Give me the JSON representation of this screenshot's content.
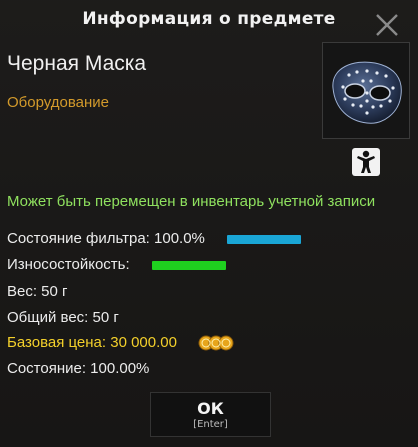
{
  "dialog": {
    "title": "Информация о предмете",
    "close_icon": "close-icon"
  },
  "item": {
    "name": "Черная Маска",
    "category": "Оборудование",
    "image_icon": "hockey-mask-icon",
    "badge_icon": "character-figure-icon",
    "account_note": "Может быть перемещен в инвентарь учетной записи"
  },
  "stats": {
    "filter_label": "Состояние фильтра: 100.0%",
    "filter_level": 1.0,
    "filter_color": "#1aa6d6",
    "durability_label": "Износостойкость:",
    "durability_level": 1.0,
    "durability_color": "#1fd01f",
    "weight": "Вес: 50 г",
    "total_weight": "Общий вес: 50 г",
    "base_price": "Базовая цена: 30 000.00",
    "coins_icon": "coins-icon",
    "condition": "Состояние: 100.00%"
  },
  "buttons": {
    "ok_label": "ОК",
    "ok_hotkey": "[Enter]"
  },
  "colors": {
    "category": "#d39a2b",
    "account_note": "#8fe15f",
    "price": "#f3d02b"
  }
}
